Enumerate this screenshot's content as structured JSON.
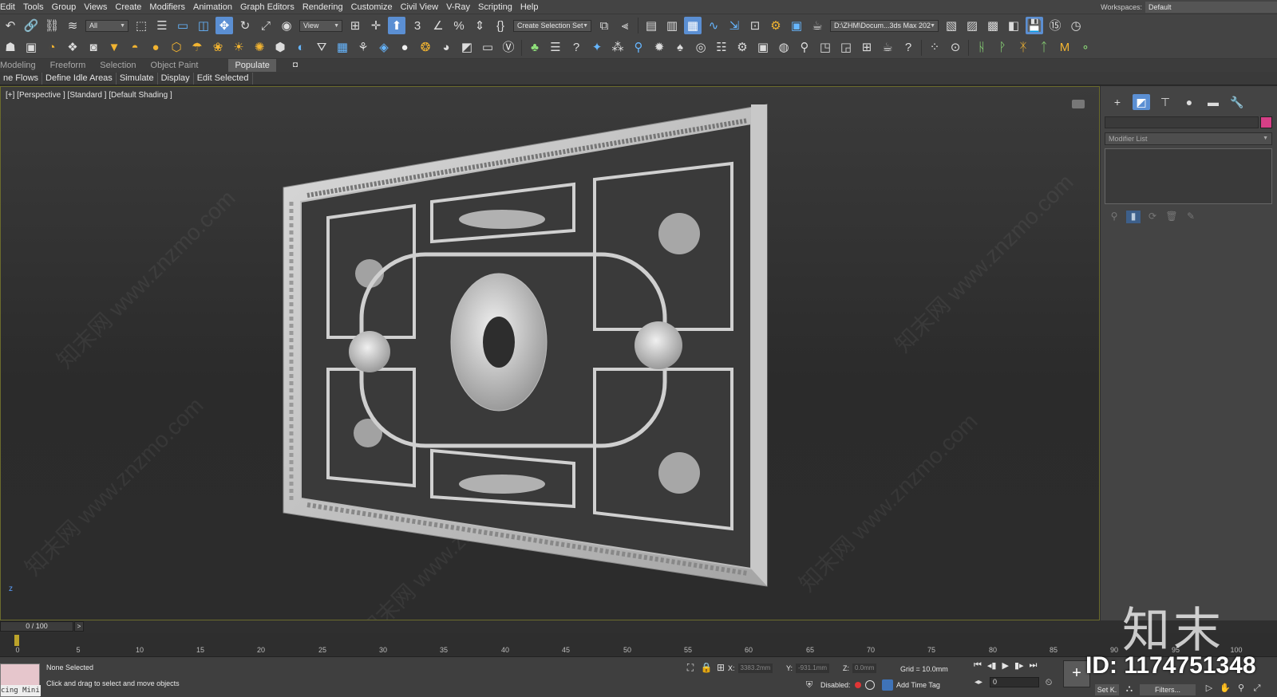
{
  "menu": [
    "Edit",
    "Tools",
    "Group",
    "Views",
    "Create",
    "Modifiers",
    "Animation",
    "Graph Editors",
    "Rendering",
    "Customize",
    "Civil View",
    "V-Ray",
    "Scripting",
    "Help"
  ],
  "workspace": {
    "label": "Workspaces:",
    "value": "Default"
  },
  "toolbar": {
    "filter_value": "All",
    "refcoord_value": "View",
    "selection_set_value": "Create Selection Set",
    "path_value": "D:\\ZHM\\Docum...3ds Max 202"
  },
  "ribbon": {
    "tabs": [
      "Modeling",
      "Freeform",
      "Selection",
      "Object Paint",
      "Populate"
    ],
    "active": "Populate",
    "sub": [
      "ne Flows",
      "Define Idle Areas",
      "Simulate",
      "Display",
      "Edit Selected"
    ]
  },
  "viewport": {
    "label": "[+] [Perspective ] [Standard ] [Default Shading ]",
    "watermark_text": "知末网 www.znzmo.com",
    "axis_label": "z"
  },
  "command_panel": {
    "modifier_list": "Modifier List",
    "color": "#d63f86"
  },
  "timeline": {
    "frame_value": "0 / 100",
    "next": ">",
    "ticks": [
      "0",
      "5",
      "10",
      "15",
      "20",
      "25",
      "30",
      "35",
      "40",
      "45",
      "50",
      "55",
      "60",
      "65",
      "70",
      "75",
      "80",
      "85",
      "90",
      "95",
      "100"
    ]
  },
  "status": {
    "mini_listener": "cing Mini",
    "selection": "None Selected",
    "prompt": "Click and drag to select and move objects",
    "x_label": "X:",
    "x_value": "3383.2mm",
    "y_label": "Y:",
    "y_value": "-931.1mm",
    "z_label": "Z:",
    "z_value": "0.0mm",
    "grid": "Grid = 10.0mm",
    "disabled": "Disabled:",
    "add_time_tag": "Add Time Tag",
    "frame_input": "0",
    "set_key": "Set K.",
    "filters": "Filters..."
  },
  "logo_text": "知末",
  "id_text": "ID: 1174751348",
  "colors": {
    "accent": "#5b8fd3",
    "viewport_border": "#6b6b2d",
    "key_color": "#d63f86"
  }
}
